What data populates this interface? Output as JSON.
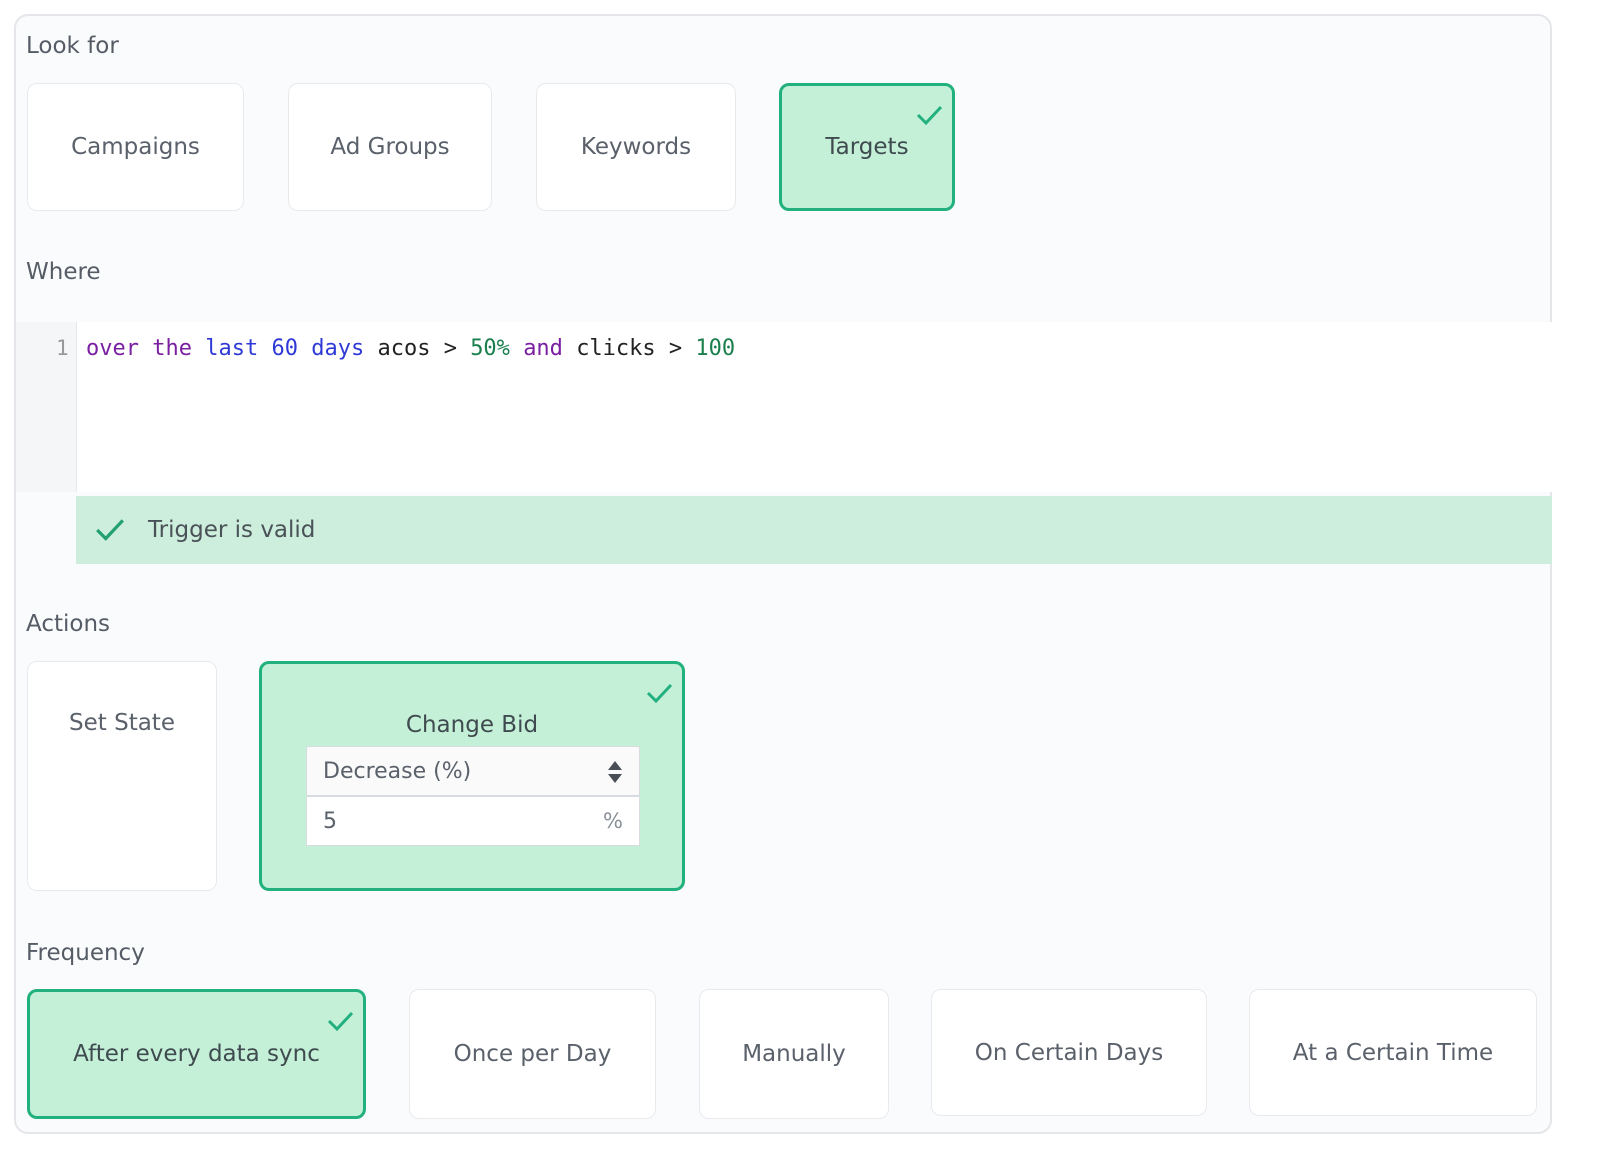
{
  "look_for": {
    "label": "Look for",
    "options": [
      "Campaigns",
      "Ad Groups",
      "Keywords",
      "Targets"
    ],
    "selected": "Targets"
  },
  "where": {
    "label": "Where",
    "line_number": "1",
    "code": {
      "t1": "over",
      "t2": "the",
      "t3": "last",
      "t4": "60",
      "t5": "days",
      "t6": "acos",
      "t7": ">",
      "t8": "50%",
      "t9": "and",
      "t10": "clicks",
      "t11": ">",
      "t12": "100"
    },
    "validation": "Trigger is valid"
  },
  "actions": {
    "label": "Actions",
    "options": [
      "Set State",
      "Change Bid"
    ],
    "selected": "Change Bid",
    "change_bid": {
      "mode": "Decrease (%)",
      "value": "5",
      "unit": "%"
    }
  },
  "frequency": {
    "label": "Frequency",
    "options": [
      "After every data sync",
      "Once per Day",
      "Manually",
      "On Certain Days",
      "At a Certain Time"
    ],
    "selected": "After every data sync"
  },
  "colors": {
    "accent": "#22b07e",
    "selected_bg": "#c4f0d8",
    "valid_bg": "#cdeedd"
  }
}
